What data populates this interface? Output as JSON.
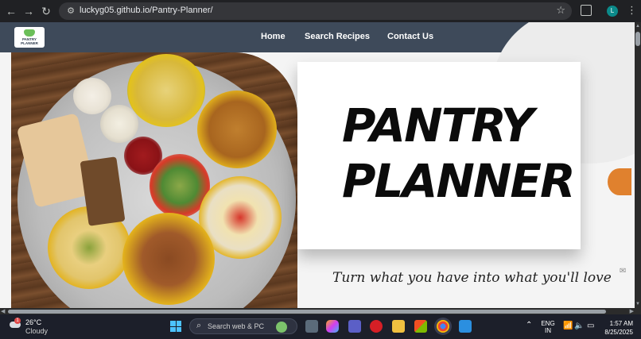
{
  "browser": {
    "url": "luckyg05.github.io/Pantry-Planner/",
    "profile_initial": "L"
  },
  "site": {
    "logo_text": "PANTRY PLANNER",
    "nav": [
      "Home",
      "Search Recipes",
      "Contact Us"
    ],
    "title_line1": "PANTRY",
    "title_line2": "PLANNER",
    "tagline": "Turn what you have into what you'll love",
    "accent_color": "#e0812e",
    "nav_color": "#3e4a5a"
  },
  "taskbar": {
    "temperature": "26°C",
    "condition": "Cloudy",
    "weather_badge": "1",
    "search_placeholder": "Search web & PC",
    "language_line1": "ENG",
    "language_line2": "IN",
    "time": "1:57 AM",
    "date": "8/25/2025"
  }
}
